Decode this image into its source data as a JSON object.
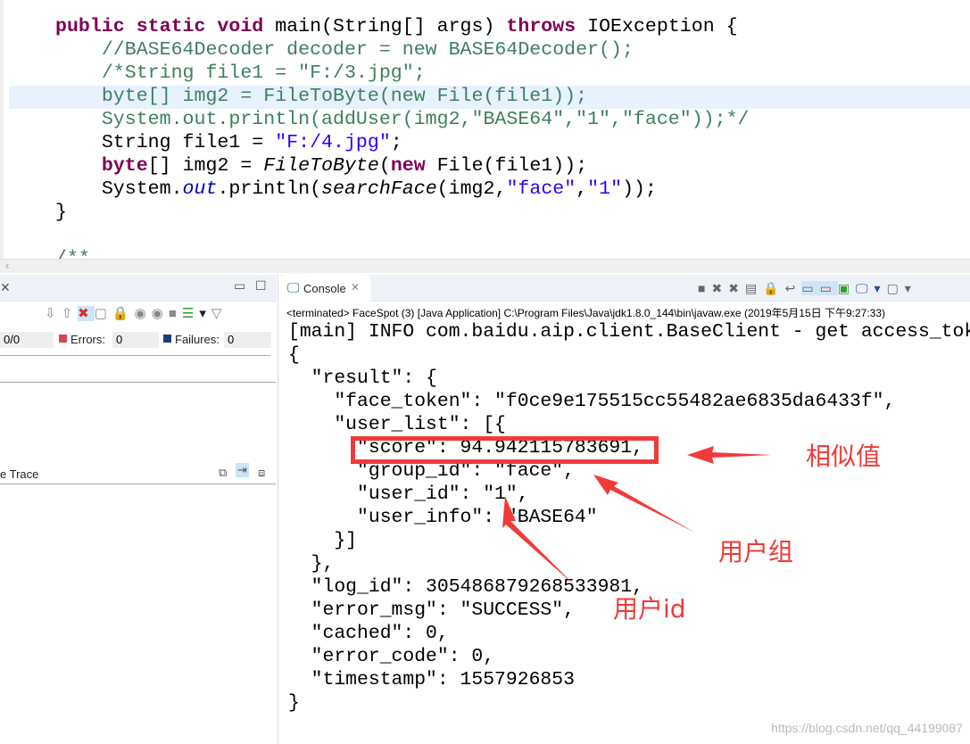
{
  "editor": {
    "lines": [
      [
        {
          "t": "public static void",
          "c": "kw"
        },
        {
          "t": " main(String[] args) ",
          "c": "pl"
        },
        {
          "t": "throws",
          "c": "kw"
        },
        {
          "t": " IOException {",
          "c": "pl"
        }
      ],
      [
        {
          "t": "    //BASE64Decoder decoder = new BASE64Decoder();",
          "c": "cm"
        }
      ],
      [
        {
          "t": "    /*String file1 = \"F:/3.jpg\";",
          "c": "cm"
        }
      ],
      [
        {
          "t": "    byte[] img2 = FileToByte(new File(file1));",
          "c": "cm"
        }
      ],
      [
        {
          "t": "    System.out.println(addUser(img2,\"BASE64\",\"1\",\"face\"));*/",
          "c": "cm"
        }
      ],
      [
        {
          "t": "    String file1 = ",
          "c": "pl"
        },
        {
          "t": "\"F:/4.jpg\"",
          "c": "str"
        },
        {
          "t": ";",
          "c": "pl"
        }
      ],
      [
        {
          "t": "    ",
          "c": "pl"
        },
        {
          "t": "byte",
          "c": "kw"
        },
        {
          "t": "[] img2 = ",
          "c": "pl"
        },
        {
          "t": "FileToByte",
          "c": "it"
        },
        {
          "t": "(",
          "c": "pl"
        },
        {
          "t": "new",
          "c": "kw"
        },
        {
          "t": " File(file1));",
          "c": "pl"
        }
      ],
      [
        {
          "t": "    System.",
          "c": "pl"
        },
        {
          "t": "out",
          "c": "fld"
        },
        {
          "t": ".println(",
          "c": "pl"
        },
        {
          "t": "searchFace",
          "c": "it"
        },
        {
          "t": "(img2,",
          "c": "pl"
        },
        {
          "t": "\"face\"",
          "c": "str"
        },
        {
          "t": ",",
          "c": "pl"
        },
        {
          "t": "\"1\"",
          "c": "str"
        },
        {
          "t": "));",
          "c": "pl"
        }
      ],
      [
        {
          "t": "}",
          "c": "pl"
        }
      ],
      [
        {
          "t": "",
          "c": "pl"
        }
      ],
      [
        {
          "t": "/**",
          "c": "cm"
        }
      ]
    ]
  },
  "junit": {
    "runs_value": "0/0",
    "errors_label": "Errors:",
    "errors_value": "0",
    "failures_label": "Failures:",
    "failures_value": "0",
    "trace_label": "e Trace"
  },
  "console": {
    "tab_label": "Console",
    "status": "<terminated> FaceSpot (3) [Java Application] C:\\Program Files\\Java\\jdk1.8.0_144\\bin\\javaw.exe (2019年5月15日 下午9:27:33)",
    "lines": [
      {
        "t": "[main] INFO com.baidu.aip.client.BaseClient - get access_token",
        "red": true
      },
      {
        "t": "{"
      },
      {
        "t": "  \"result\": {"
      },
      {
        "t": "    \"face_token\": \"f0ce9e175515cc55482ae6835da6433f\","
      },
      {
        "t": "    \"user_list\": [{"
      },
      {
        "t": "      \"score\": 94.942115783691,"
      },
      {
        "t": "      \"group_id\": \"face\","
      },
      {
        "t": "      \"user_id\": \"1\","
      },
      {
        "t": "      \"user_info\": \"BASE64\""
      },
      {
        "t": "    }]"
      },
      {
        "t": "  },"
      },
      {
        "t": "  \"log_id\": 305486879268533981,"
      },
      {
        "t": "  \"error_msg\": \"SUCCESS\","
      },
      {
        "t": "  \"cached\": 0,"
      },
      {
        "t": "  \"error_code\": 0,"
      },
      {
        "t": "  \"timestamp\": 1557926853"
      },
      {
        "t": "}"
      }
    ]
  },
  "annotations": {
    "similarity": "相似值",
    "group": "用户组",
    "user_id": "用户id",
    "color": "#f03a3a"
  },
  "watermark": "https://blog.csdn.net/qq_44199087"
}
